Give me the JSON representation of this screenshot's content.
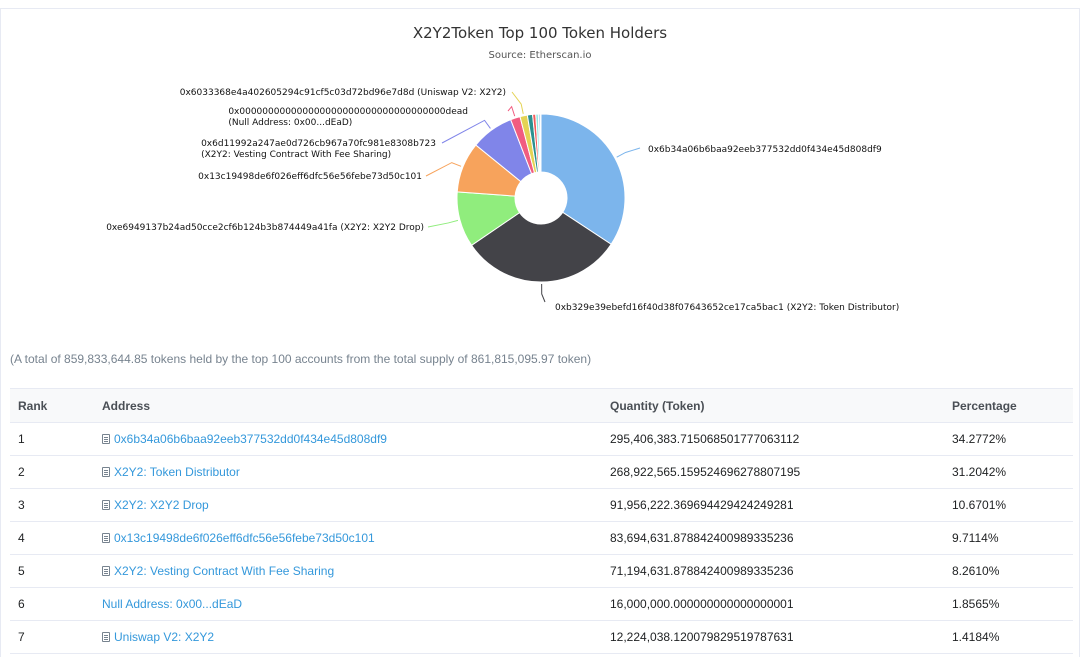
{
  "chart_data": {
    "type": "pie",
    "title": "X2Y2Token Top 100 Token Holders",
    "subtitle": "Source: Etherscan.io",
    "slices": [
      {
        "label": "0x6b34a06b6baa92eeb377532dd0f434e45d808df9",
        "value": 34.2772,
        "color": "#7cb5ec"
      },
      {
        "label": "0xb329e39ebefd16f40d38f07643652ce17ca5bac1 (X2Y2: Token Distributor)",
        "value": 31.2042,
        "color": "#434348"
      },
      {
        "label": "0xe6949137b24ad50cce2cf6b124b3b874449a41fa (X2Y2: X2Y2 Drop)",
        "value": 10.6701,
        "color": "#90ed7d"
      },
      {
        "label": "0x13c19498de6f026eff6dfc56e56febe73d50c101",
        "value": 9.7114,
        "color": "#f7a35c"
      },
      {
        "label": "0x6d11992a247ae0d726cb967a70fc981e8308b723",
        "label2": "(X2Y2: Vesting Contract With Fee Sharing)",
        "value": 8.261,
        "color": "#8085e9"
      },
      {
        "label": "0x000000000000000000000000000000000000dead",
        "label2": "(Null Address: 0x00...dEaD)",
        "value": 1.8565,
        "color": "#f15c80"
      },
      {
        "label": "0x6033368e4a402605294c91cf5c03d72bd96e7d8d (Uniswap V2: X2Y2)",
        "value": 1.4184,
        "color": "#e4d354"
      },
      {
        "label": "",
        "value": 1.0,
        "color": "#2b908f"
      },
      {
        "label": "",
        "value": 0.6,
        "color": "#f45b5b"
      },
      {
        "label": "",
        "value": 0.5,
        "color": "#91e8e1"
      },
      {
        "label": "",
        "value": 0.3,
        "color": "#7cb5ec"
      },
      {
        "label": "",
        "value": 0.2,
        "color": "#cccccc"
      }
    ]
  },
  "summary": "(A total of 859,833,644.85 tokens held by the top 100 accounts from the total supply of 861,815,095.97 token)",
  "table": {
    "headers": [
      "Rank",
      "Address",
      "Quantity (Token)",
      "Percentage"
    ],
    "rows": [
      {
        "rank": "1",
        "address": "0x6b34a06b6baa92eeb377532dd0f434e45d808df9",
        "icon": "contract-icon",
        "quantity": "295,406,383.715068501777063112",
        "percentage": "34.2772%"
      },
      {
        "rank": "2",
        "address": "X2Y2: Token Distributor",
        "icon": "contract-icon",
        "quantity": "268,922,565.15952469627880719​5",
        "percentage": "31.2042%"
      },
      {
        "rank": "3",
        "address": "X2Y2: X2Y2 Drop",
        "icon": "contract-icon",
        "quantity": "91,956,222.369694429424249281",
        "percentage": "10.6701%"
      },
      {
        "rank": "4",
        "address": "0x13c19498de6f026eff6dfc56e56febe73d50c101",
        "icon": "contract-icon",
        "quantity": "83,694,631.878842400989335236",
        "percentage": "9.7114%"
      },
      {
        "rank": "5",
        "address": "X2Y2: Vesting Contract With Fee Sharing",
        "icon": "contract-icon",
        "quantity": "71,194,631.878842400989335236",
        "percentage": "8.2610%"
      },
      {
        "rank": "6",
        "address": "Null Address: 0x00...dEaD",
        "icon": "",
        "quantity": "16,000,000.000000000000000001",
        "percentage": "1.8565%"
      },
      {
        "rank": "7",
        "address": "Uniswap V2: X2Y2",
        "icon": "contract-icon",
        "quantity": "12,224,038.120079829519787631",
        "percentage": "1.4184%"
      }
    ]
  }
}
